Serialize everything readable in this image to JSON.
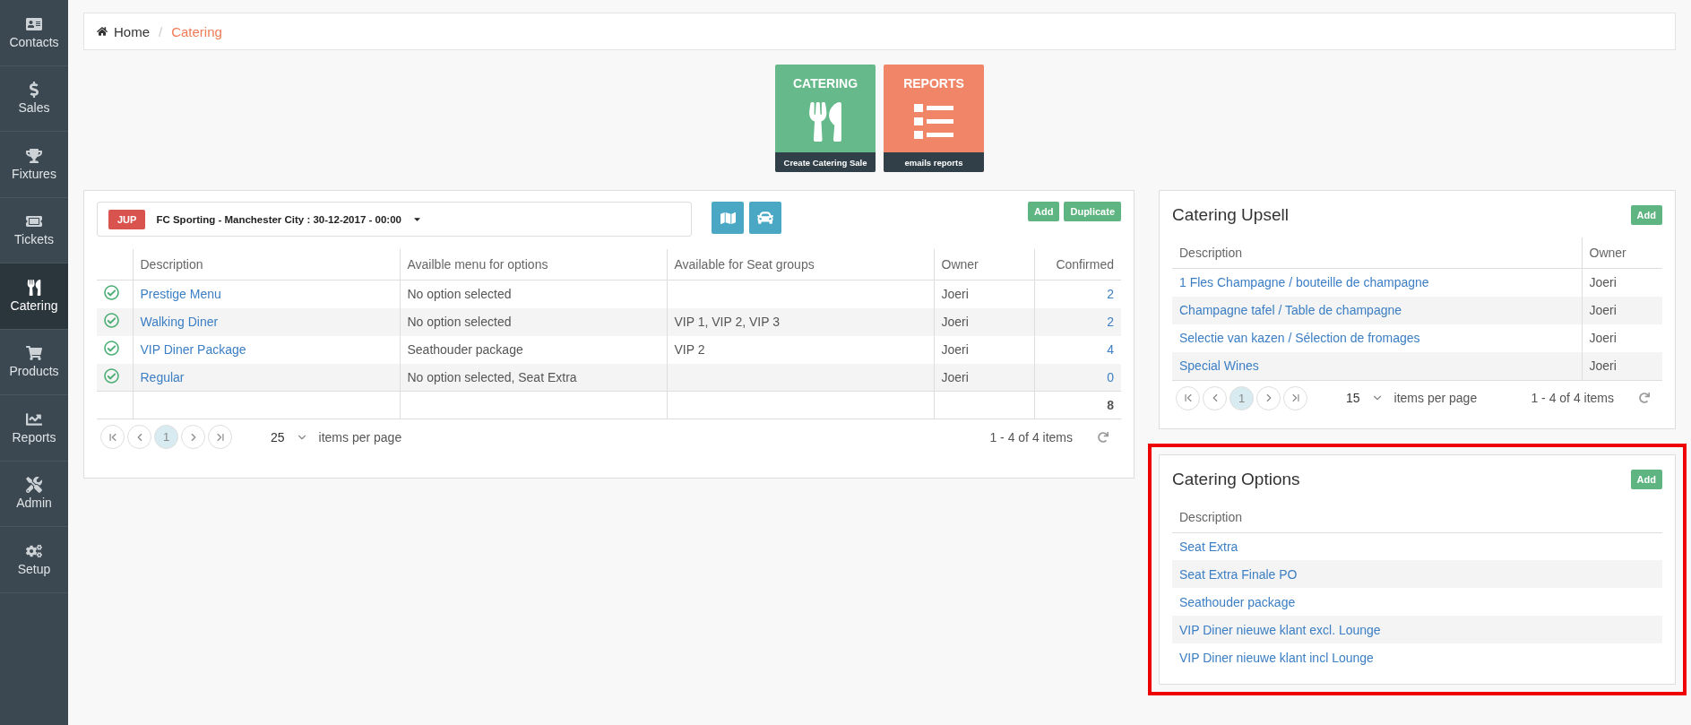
{
  "sidebar": {
    "items": [
      {
        "label": "Contacts",
        "kind": "contacts",
        "selected": false
      },
      {
        "label": "Sales",
        "kind": "sales",
        "selected": false
      },
      {
        "label": "Fixtures",
        "kind": "fixtures",
        "selected": false
      },
      {
        "label": "Tickets",
        "kind": "tickets",
        "selected": false
      },
      {
        "label": "Catering",
        "kind": "catering",
        "selected": true
      },
      {
        "label": "Products",
        "kind": "products",
        "selected": false
      },
      {
        "label": "Reports",
        "kind": "reports",
        "selected": false
      },
      {
        "label": "Admin",
        "kind": "admin",
        "selected": false
      },
      {
        "label": "Setup",
        "kind": "setup",
        "selected": false
      }
    ]
  },
  "breadcrumb": {
    "separator": "/",
    "items": [
      {
        "label": "Home",
        "kind": "home",
        "current": false
      },
      {
        "label": "Catering",
        "kind": "page",
        "current": true
      }
    ]
  },
  "tiles": [
    {
      "title": "CATERING",
      "caption": "Create Catering Sale",
      "kind": "catering",
      "color": "#66b98a"
    },
    {
      "title": "REPORTS",
      "caption": "emails reports",
      "kind": "reports",
      "color": "#f08667"
    }
  ],
  "fixture_panel": {
    "selector": {
      "badge": "JUP",
      "label": "FC Sporting - Manchester City : 30-12-2017 - 00:00"
    },
    "tool_buttons": [
      {
        "kind": "map"
      },
      {
        "kind": "car"
      }
    ],
    "buttons": [
      "Add",
      "Duplicate"
    ],
    "table": {
      "columns": [
        "Description",
        "Availble menu for options",
        "Available for Seat groups",
        "Owner",
        "Confirmed"
      ],
      "rows": [
        {
          "checked": true,
          "description": "Prestige Menu",
          "menu_options": "No option selected",
          "seat_groups": "",
          "owner": "Joeri",
          "confirmed": "2"
        },
        {
          "checked": true,
          "description": "Walking Diner",
          "menu_options": "No option selected",
          "seat_groups": "VIP 1, VIP 2, VIP 3",
          "owner": "Joeri",
          "confirmed": "2"
        },
        {
          "checked": true,
          "description": "VIP Diner Package",
          "menu_options": "Seathouder package",
          "seat_groups": "VIP 2",
          "owner": "Joeri",
          "confirmed": "4"
        },
        {
          "checked": true,
          "description": "Regular",
          "menu_options": "No option selected, Seat Extra",
          "seat_groups": "",
          "owner": "Joeri",
          "confirmed": "0"
        }
      ],
      "total": "8"
    },
    "pager": {
      "pages": [
        {
          "label": "1",
          "selected": true
        }
      ],
      "page_size": "25",
      "page_size_label": "items per page",
      "summary": "1 - 4 of 4 items"
    }
  },
  "upsell_panel": {
    "title": "Catering Upsell",
    "add_button": "Add",
    "columns": [
      "Description",
      "Owner"
    ],
    "rows": [
      {
        "description": "1 Fles Champagne / bouteille de champagne",
        "owner": "Joeri"
      },
      {
        "description": "Champagne tafel / Table de champagne",
        "owner": "Joeri"
      },
      {
        "description": "Selectie van kazen / Sélection de fromages",
        "owner": "Joeri"
      },
      {
        "description": "Special Wines",
        "owner": "Joeri"
      }
    ],
    "pager": {
      "pages": [
        {
          "label": "1",
          "selected": true
        }
      ],
      "page_size": "15",
      "page_size_label": "items per page",
      "summary": "1 - 4 of 4 items"
    }
  },
  "options_panel": {
    "title": "Catering Options",
    "add_button": "Add",
    "highlighted": true,
    "columns": [
      "Description"
    ],
    "rows": [
      {
        "description": "Seat Extra"
      },
      {
        "description": "Seat Extra Finale PO"
      },
      {
        "description": "Seathouder package"
      },
      {
        "description": "VIP Diner nieuwe klant excl. Lounge"
      },
      {
        "description": "VIP Diner nieuwe klant incl Lounge"
      }
    ]
  }
}
